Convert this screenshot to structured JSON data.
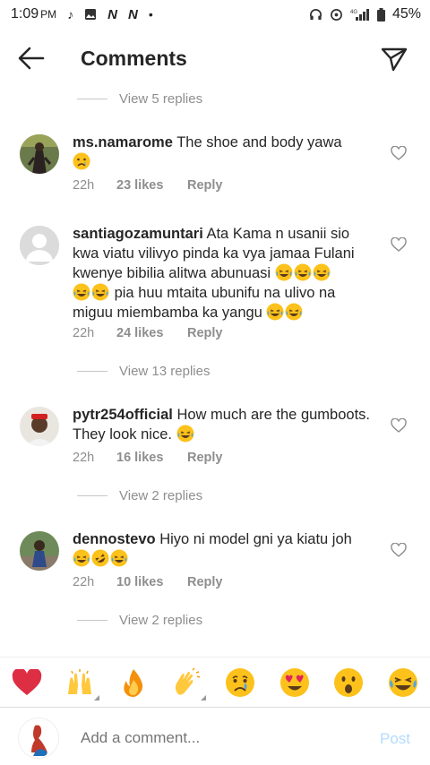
{
  "status_bar": {
    "time": "1:09",
    "ampm": "PM",
    "battery": "45%"
  },
  "header": {
    "title": "Comments"
  },
  "comments": [
    {
      "username": "ms.namarome",
      "text": "The shoe and body yawa",
      "emojis": [
        "sad-face"
      ],
      "time": "22h",
      "likes": "23 likes",
      "reply": "Reply",
      "replies": null
    },
    {
      "username": "santiagozamuntari",
      "text": "Ata Kama n usanii sio kwa viatu vilivyo pinda ka vya jamaa Fulani kwenye bibilia alitwa abunuasi",
      "text_line3_tail": "pia huu mtaita ubunifu na ulivo na miguu miembamba ka yangu",
      "time": "22h",
      "likes": "24 likes",
      "reply": "Reply",
      "replies": "View 13 replies"
    },
    {
      "username": "pytr254official",
      "text": "How much are the gumboots. They look nice.",
      "time": "22h",
      "likes": "16 likes",
      "reply": "Reply",
      "replies": "View 2 replies"
    },
    {
      "username": "dennostevo",
      "text": "Hiyo ni model gni ya kiatu joh",
      "time": "22h",
      "likes": "10 likes",
      "reply": "Reply",
      "replies": "View 2 replies"
    }
  ],
  "top_replies": "View 5 replies",
  "emoji_bar": [
    "heart",
    "raised-hands",
    "fire",
    "clapping-hands",
    "crying-face",
    "heart-eyes",
    "surprised-face",
    "laughing-tears"
  ],
  "composer": {
    "placeholder": "Add a comment...",
    "post_label": "Post"
  },
  "colors": {
    "accent": "#0095f6",
    "post_disabled": "#b3dbff",
    "muted": "#8e8e8e",
    "heart": "#ed4956"
  }
}
